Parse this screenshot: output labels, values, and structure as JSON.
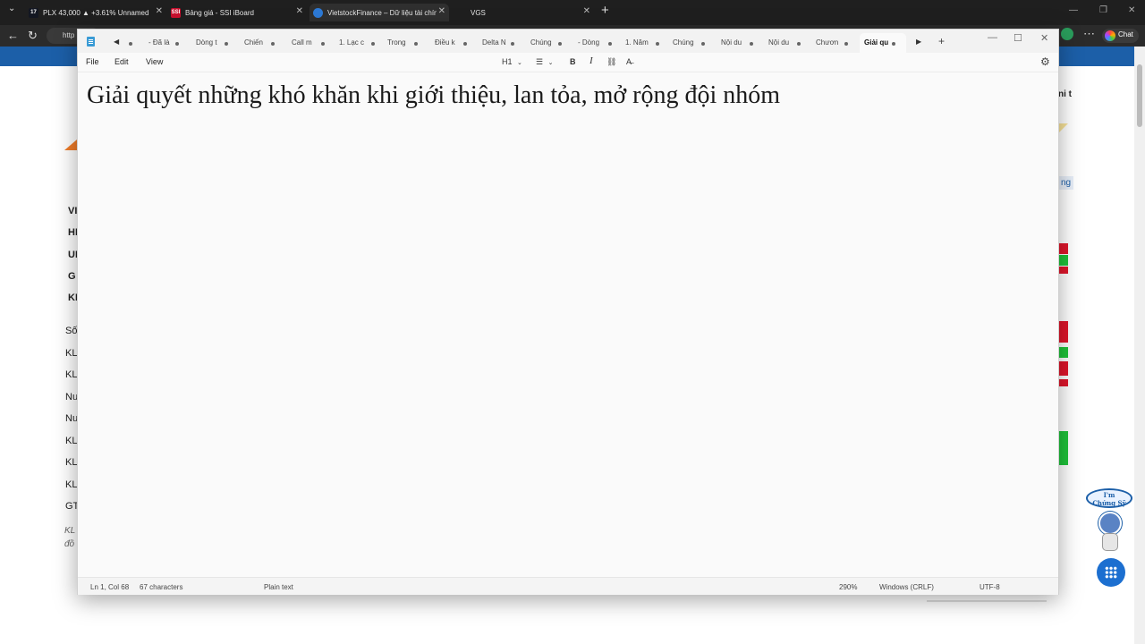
{
  "browser": {
    "tabs": [
      {
        "label": "PLX 43,000 ▲ +3.61% Unnamed",
        "favicon": "TV",
        "favcolor": "#131722"
      },
      {
        "label": "Bảng giá - SSI iBoard",
        "favicon": "SSI",
        "favcolor": "#c8102e"
      },
      {
        "label": "VietstockFinance – Dữ liệu tài chính",
        "favicon": "",
        "favcolor": "#2d7ad6"
      },
      {
        "label": "VGS",
        "favicon": "",
        "favcolor": "#1f1f1f"
      }
    ],
    "address_text": "http",
    "chat_label": "Chat"
  },
  "webpage": {
    "bold_rows": [
      "VI",
      "HI",
      "UI",
      "G",
      "KI"
    ],
    "rows": [
      "Số",
      "KL",
      "KL",
      "Nu",
      "Nu",
      "KL",
      "KL",
      "KL",
      "GT"
    ],
    "italic_notes": [
      "KL",
      "đồ"
    ],
    "right_snippet": "ni t",
    "right_button": "ng",
    "mascot_text_1": "I'm",
    "mascot_text_2": "Chứng Sỹ"
  },
  "notepad": {
    "tabs": [
      "- Đã là",
      "Dòng t",
      "Chiến",
      "Call m",
      "1. Lạc c",
      "Trong",
      "Điều k",
      "Delta N",
      "Chúng",
      "- Dòng",
      "1. Năm",
      "Chúng",
      "Nội du",
      "Nội du",
      "Chươn",
      "Giải qu"
    ],
    "active_tab_index": 15,
    "menu": {
      "file": "File",
      "edit": "Edit",
      "view": "View"
    },
    "format": {
      "heading": "H1",
      "bold": "B",
      "italic": "I"
    },
    "content": "Giải quyết những khó khăn khi giới thiệu, lan tỏa, mở rộng đội nhóm",
    "status": {
      "position": "Ln 1, Col 68",
      "characters": "67 characters",
      "mode": "Plain text",
      "zoom": "290%",
      "line_ending": "Windows (CRLF)",
      "encoding": "UTF-8"
    }
  }
}
